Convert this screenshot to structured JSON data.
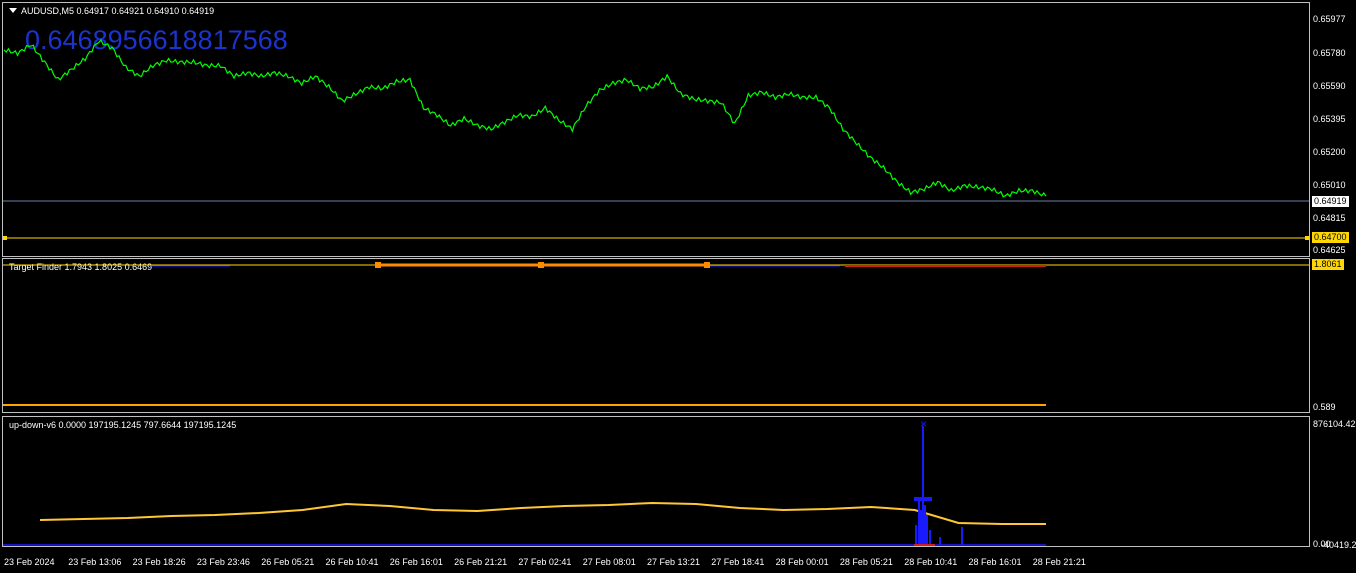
{
  "chart_data": [
    {
      "type": "line",
      "title": "AUDUSD,M5  0.64917 0.64921 0.64910 0.64919",
      "overlay_value": "0.6468956618817568",
      "y_ticks": [
        "0.65977",
        "0.65780",
        "0.65590",
        "0.65395",
        "0.65200",
        "0.65010",
        "0.64815",
        "0.64625"
      ],
      "ylim": [
        0.6458,
        0.6601
      ],
      "current_price": "0.64919",
      "level_line": "0.64700",
      "series_color": "#00ff00",
      "series": [
        {
          "values": [
            0.6575,
            0.6573,
            0.6578,
            0.6568,
            0.6558,
            0.6564,
            0.657,
            0.658,
            0.6576,
            0.6565,
            0.656,
            0.6566,
            0.6569,
            0.6568,
            0.6568,
            0.6566,
            0.6566,
            0.656,
            0.6562,
            0.656,
            0.6562,
            0.656,
            0.6556,
            0.656,
            0.6554,
            0.6546,
            0.655,
            0.6554,
            0.6553,
            0.6557,
            0.6558,
            0.6542,
            0.6538,
            0.6532,
            0.6536,
            0.6532,
            0.653,
            0.6534,
            0.6538,
            0.6537,
            0.6542,
            0.6535,
            0.653,
            0.6543,
            0.6552,
            0.6556,
            0.6558,
            0.6553,
            0.6554,
            0.656,
            0.655,
            0.6547,
            0.6546,
            0.6545,
            0.6533,
            0.6549,
            0.6551,
            0.6548,
            0.655,
            0.6548,
            0.6548,
            0.6542,
            0.653,
            0.6522,
            0.6514,
            0.6508,
            0.65,
            0.6494,
            0.6496,
            0.65,
            0.6495,
            0.6498,
            0.6497,
            0.6496,
            0.6492,
            0.6495,
            0.6495,
            0.6492
          ],
          "color": "#00ff00"
        }
      ]
    },
    {
      "type": "line",
      "title": "Target Finder 1.7943 1.8025 0.6469",
      "y_ticks": [
        "1.8061",
        "0.589"
      ],
      "top_value": "1.8061",
      "bottom_value": "0.589",
      "series": [
        {
          "values": [
            1.8,
            1.8,
            1.8,
            1.8,
            1.8
          ],
          "color": "#ff8c00"
        }
      ]
    },
    {
      "type": "area",
      "title": "up-down-v6 0.0000 197195.1245 797.6644 197195.1245",
      "y_ticks": [
        "876104.42",
        "0.00",
        "-40419.25"
      ],
      "ylim": [
        -40419.25,
        876104.42
      ],
      "series": [
        {
          "values": [
            20,
            21,
            22,
            24,
            25,
            27,
            30,
            36,
            34,
            30,
            29,
            32,
            34,
            35,
            37,
            36,
            32,
            30,
            31,
            33,
            30,
            17,
            16,
            16
          ],
          "color": "#ffc832"
        },
        {
          "values": [
            0,
            0,
            0,
            0,
            0,
            0,
            0,
            0,
            0,
            0,
            0,
            0,
            0,
            0,
            0,
            0,
            0,
            0,
            0,
            0,
            0,
            876104,
            150000,
            30000
          ],
          "color": "#1a1aff"
        }
      ]
    }
  ],
  "time_axis": [
    "23 Feb 2024",
    "23 Feb 13:06",
    "23 Feb 18:26",
    "23 Feb 23:46",
    "26 Feb 05:21",
    "26 Feb 10:41",
    "26 Feb 16:01",
    "26 Feb 21:21",
    "27 Feb 02:41",
    "27 Feb 08:01",
    "27 Feb 13:21",
    "27 Feb 18:41",
    "28 Feb 00:01",
    "28 Feb 05:21",
    "28 Feb 10:41",
    "28 Feb 16:01",
    "28 Feb 21:21"
  ],
  "colors": {
    "bg": "#000000",
    "price": "#00ff00",
    "level": "#ffd700",
    "accent_blue": "#1c33d0",
    "orange": "#ffa500"
  }
}
